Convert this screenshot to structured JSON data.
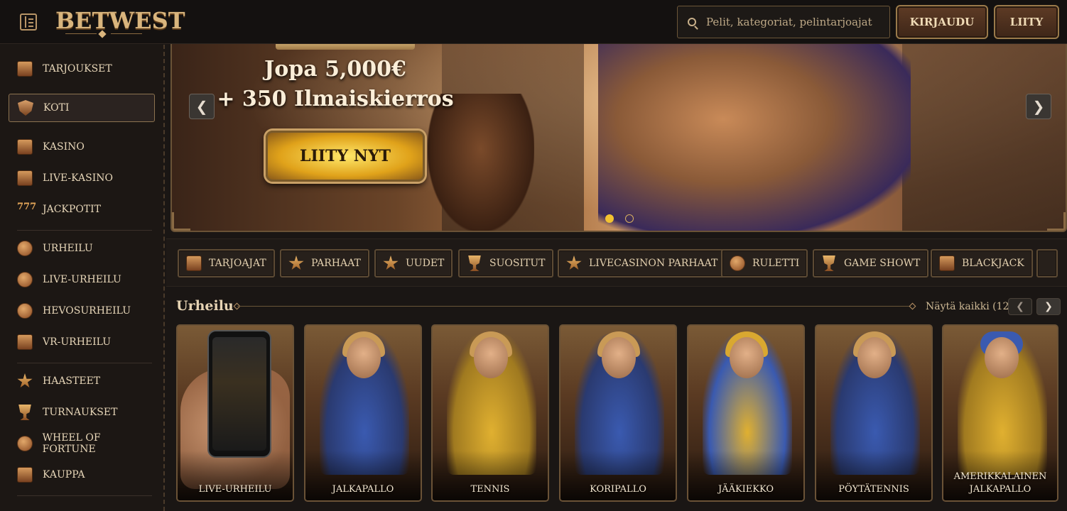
{
  "header": {
    "logo": "BETWEST",
    "search_placeholder": "Pelit, kategoriat, pelintarjoajat",
    "login_label": "KIRJAUDU",
    "join_label": "LIITY"
  },
  "sidebar": {
    "items": [
      {
        "label": "TARJOUKSET",
        "icon": "gift-icon"
      },
      {
        "label": "KOTI",
        "icon": "home-shield-icon"
      },
      {
        "label": "KASINO",
        "icon": "casino-chest-icon"
      },
      {
        "label": "LIVE-KASINO",
        "icon": "playing-cards-icon"
      },
      {
        "label": "JACKPOTIT",
        "icon": "sevens-icon"
      },
      {
        "label": "URHEILU",
        "icon": "ball-icon"
      },
      {
        "label": "LIVE-URHEILU",
        "icon": "live-badge-icon"
      },
      {
        "label": "HEVOSURHEILU",
        "icon": "jockey-helmet-icon"
      },
      {
        "label": "VR-URHEILU",
        "icon": "joystick-icon"
      },
      {
        "label": "HAASTEET",
        "icon": "sheriff-badge-icon"
      },
      {
        "label": "TURNAUKSET",
        "icon": "trophy-icon"
      },
      {
        "label": "WHEEL OF FORTUNE",
        "icon": "wheel-icon"
      },
      {
        "label": "KAUPPA",
        "icon": "basket-icon"
      }
    ]
  },
  "banner": {
    "line1": "Jopa 5,000€",
    "line2": "+ 350 Ilmaiskierros",
    "cta": "LIITY NYT",
    "prev": "❮",
    "next": "❯"
  },
  "categories": [
    {
      "label": "TARJOAJAT",
      "icon": "book-icon"
    },
    {
      "label": "PARHAAT",
      "icon": "star-icon"
    },
    {
      "label": "UUDET",
      "icon": "lightning-icon"
    },
    {
      "label": "SUOSITUT",
      "icon": "fist-icon"
    },
    {
      "label": "LIVECASINON PARHAAT",
      "icon": "star-icon"
    },
    {
      "label": "RULETTI",
      "icon": "roulette-icon"
    },
    {
      "label": "GAME SHOWT",
      "icon": "microphone-icon"
    },
    {
      "label": "BLACKJACK",
      "icon": "cards-icon"
    }
  ],
  "sports_section": {
    "title": "Urheilu",
    "view_all": "Näytä kaikki (12)",
    "prev": "❮",
    "next": "❯",
    "cards": [
      {
        "label": "LIVE-URHEILU"
      },
      {
        "label": "JALKAPALLO"
      },
      {
        "label": "TENNIS"
      },
      {
        "label": "KORIPALLO"
      },
      {
        "label": "JÄÄKIEKKO"
      },
      {
        "label": "PÖYTÄTENNIS"
      },
      {
        "label": "AMERIKKALAINEN JALKAPALLO"
      }
    ]
  },
  "colors": {
    "accent_gold": "#d9b57d",
    "background": "#1a1614",
    "active_dot": "#f2c230"
  }
}
